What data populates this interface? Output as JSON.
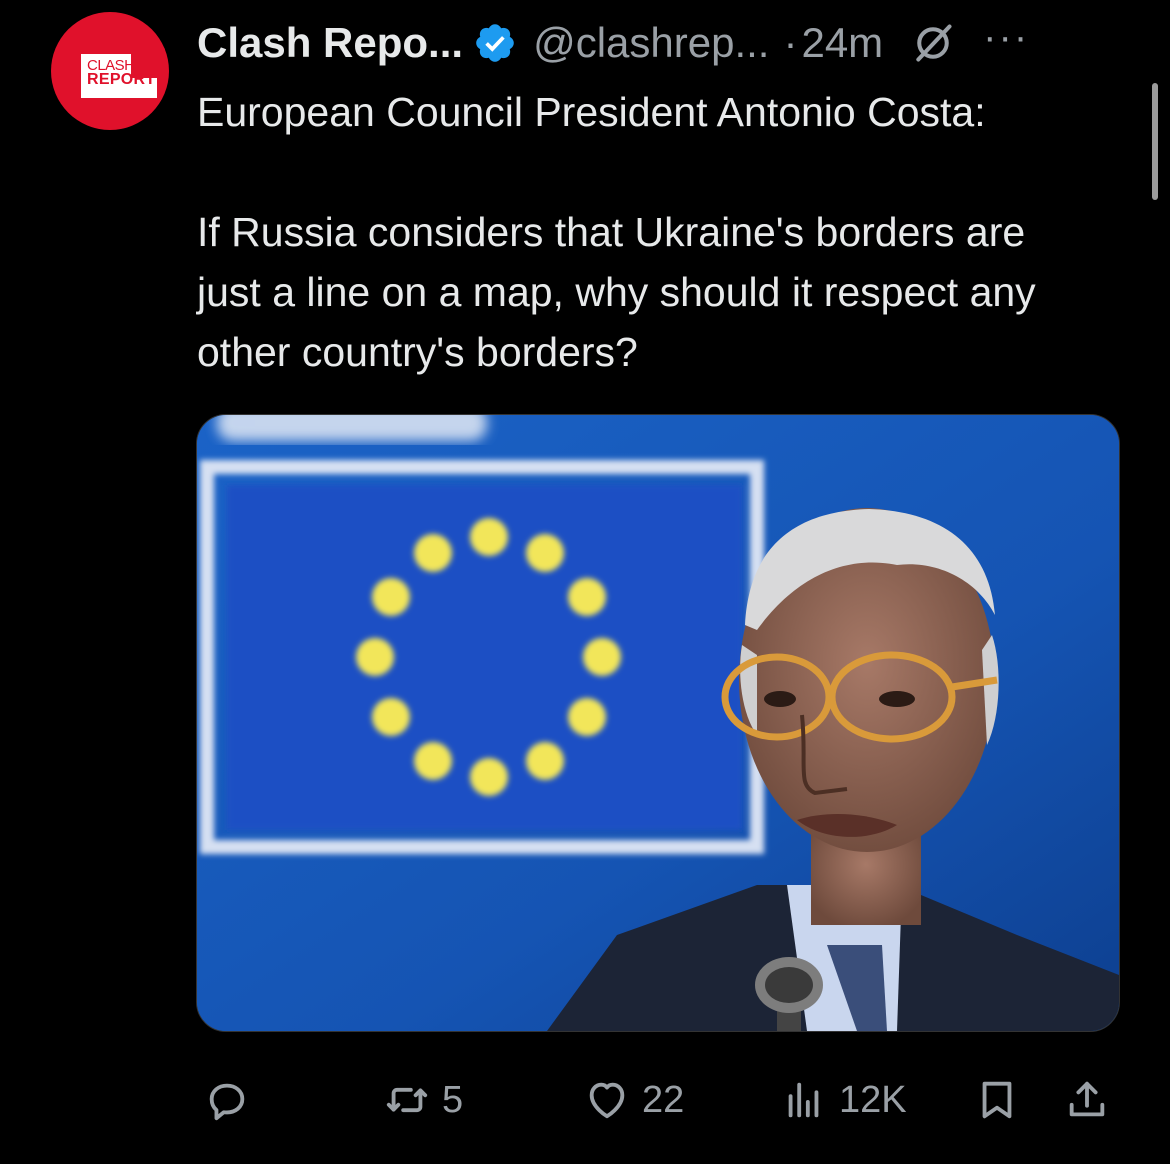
{
  "account": {
    "avatar_line1": "CLASH",
    "avatar_line2": "REPORT",
    "display_name": "Clash Repo...",
    "handle": "@clashrep...",
    "separator": "·",
    "time": "24m",
    "more": "···"
  },
  "tweet": {
    "line1": "European Council President Antonio Costa:",
    "body": "If Russia considers that Ukraine's borders are just a line on a map, why should it respect any other country's borders?"
  },
  "media": {
    "description_icon": "photo"
  },
  "actions": {
    "reply_count": "",
    "retweet_count": "5",
    "like_count": "22",
    "views_count": "12K"
  },
  "icons": {
    "verified": "verified-badge-icon",
    "grok": "slash-circle-icon",
    "reply": "reply-icon",
    "retweet": "retweet-icon",
    "like": "heart-icon",
    "views": "views-icon",
    "bookmark": "bookmark-icon",
    "share": "share-icon"
  },
  "colors": {
    "background": "#000000",
    "text": "#e7e9ea",
    "muted": "#9aa0a6",
    "verified": "#1d9bf0",
    "brand_red": "#e0112b"
  }
}
